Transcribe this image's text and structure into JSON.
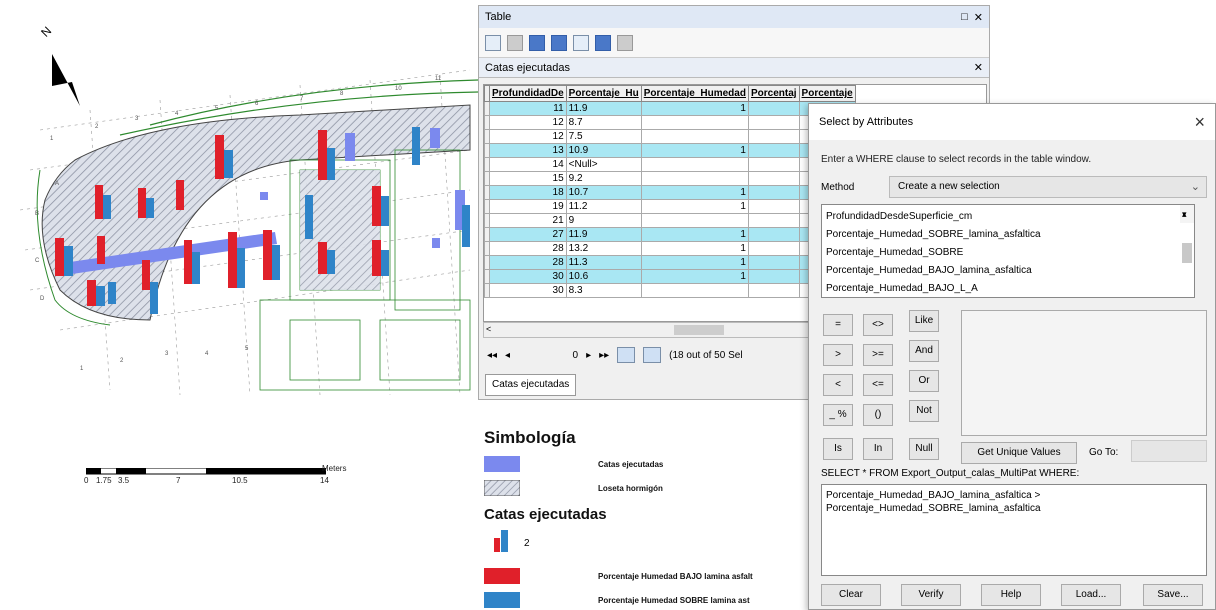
{
  "colors": {
    "selected_row": "#a9e7f3",
    "bajo_red": "#e0202a",
    "sobre_blue": "#2f84c8",
    "catas_lavender": "#7b89ee",
    "hatch_grey": "#9aa0ae",
    "road_green": "#2e8a2e"
  },
  "icons": [
    "north-arrow",
    "table-options-icon",
    "select-by-attributes-icon",
    "switch-selection-icon",
    "clear-selection-icon",
    "delete-icon"
  ],
  "map": {
    "scale_labels": [
      "0",
      "1.75",
      "3.5",
      "7",
      "10.5",
      "14"
    ],
    "scale_units": "Meters",
    "north_label": "N"
  },
  "table_window": {
    "title": "Table",
    "layer_name": "Catas ejecutadas",
    "columns": [
      "ProfundidadDe",
      "Porcentaje_Hu",
      "Porcentaje_Humedad",
      "Porcentaj",
      "Porcentaje"
    ],
    "rows": [
      {
        "depth": "11",
        "value": "11.9",
        "col3": "1",
        "selected": true
      },
      {
        "depth": "12",
        "value": "8.7",
        "col3": "",
        "selected": false
      },
      {
        "depth": "12",
        "value": "7.5",
        "col3": "",
        "selected": false
      },
      {
        "depth": "13",
        "value": "10.9",
        "col3": "1",
        "selected": true
      },
      {
        "depth": "14",
        "value": "<Null>",
        "col3": "",
        "selected": false
      },
      {
        "depth": "15",
        "value": "9.2",
        "col3": "",
        "selected": false
      },
      {
        "depth": "18",
        "value": "10.7",
        "col3": "1",
        "selected": true
      },
      {
        "depth": "19",
        "value": "11.2",
        "col3": "1",
        "selected": false
      },
      {
        "depth": "21",
        "value": "9",
        "col3": "",
        "selected": false
      },
      {
        "depth": "27",
        "value": "11.9",
        "col3": "1",
        "selected": true
      },
      {
        "depth": "28",
        "value": "13.2",
        "col3": "1",
        "selected": false
      },
      {
        "depth": "28",
        "value": "11.3",
        "col3": "1",
        "selected": true
      },
      {
        "depth": "30",
        "value": "10.6",
        "col3": "1",
        "selected": true
      },
      {
        "depth": "30",
        "value": "8.3",
        "col3": "",
        "selected": false
      }
    ],
    "record_position": "0",
    "selection_status": "(18 out of 50 Sel",
    "tab_label": "Catas ejecutadas"
  },
  "legend": {
    "title": "Simbología",
    "items": [
      {
        "label": "Catas ejecutadas"
      },
      {
        "label": "Loseta hormigón"
      }
    ],
    "group_title": "Catas ejecutadas",
    "chart_value": "2",
    "series": [
      {
        "label": "Porcentaje Humedad BAJO lamina asfalt"
      },
      {
        "label": "Porcentaje Humedad SOBRE lamina ast"
      }
    ]
  },
  "dialog": {
    "title": "Select by Attributes",
    "description": "Enter a WHERE clause to select records in the table window.",
    "method_label": "Method",
    "method_value": "Create a new selection",
    "fields": [
      "ProfundidadDesdeSuperficie_cm",
      "Porcentaje_Humedad_SOBRE_lamina_asfaltica",
      "Porcentaje_Humedad_SOBRE",
      "Porcentaje_Humedad_BAJO_lamina_asfaltica",
      "Porcentaje_Humedad_BAJO_L_A"
    ],
    "operators": {
      "eq": "=",
      "ne": "<>",
      "like": "Like",
      "gt": ">",
      "ge": ">=",
      "and": "And",
      "lt": "<",
      "le": "<=",
      "or": "Or",
      "pct": "_ %",
      "paren": "()",
      "not": "Not",
      "is": "Is",
      "in": "In",
      "null": "Null"
    },
    "get_unique": "Get Unique Values",
    "goto_label": "Go To:",
    "sql_prefix": "SELECT * FROM Export_Output_calas_MultiPat WHERE:",
    "sql_lines": [
      "Porcentaje_Humedad_BAJO_lamina_asfaltica >",
      "Porcentaje_Humedad_SOBRE_lamina_asfaltica"
    ],
    "buttons": {
      "clear": "Clear",
      "verify": "Verify",
      "help": "Help",
      "load": "Load...",
      "save": "Save..."
    }
  }
}
